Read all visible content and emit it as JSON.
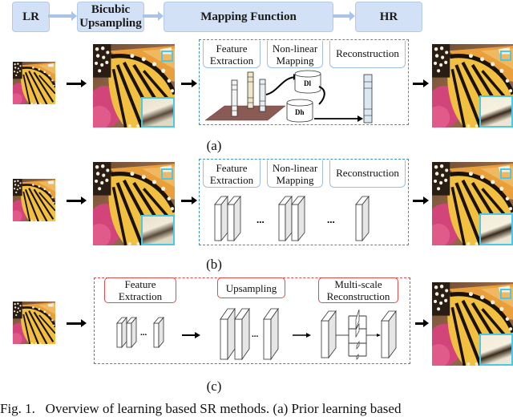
{
  "header": {
    "stages": [
      {
        "label": "LR"
      },
      {
        "label": "Bicubic\nUpsampling"
      },
      {
        "label": "Mapping Function"
      },
      {
        "label": "HR"
      }
    ]
  },
  "rows": [
    {
      "id": "a",
      "sublabel": "(a)",
      "stages": [
        "Feature\nExtraction",
        "Non-linear\nMapping",
        "Reconstruction"
      ],
      "dictionaries": [
        "Dl",
        "Dh"
      ],
      "box_color": "#3f8fd0"
    },
    {
      "id": "b",
      "sublabel": "(b)",
      "stages": [
        "Feature\nExtraction",
        "Non-linear\nMapping",
        "Reconstruction"
      ],
      "ellipsis": [
        "...",
        "..."
      ],
      "box_color": "#3f8fd0"
    },
    {
      "id": "c",
      "sublabel": "(c)",
      "stages": [
        "Feature\nExtraction",
        "Upsampling",
        "Multi-scale\nReconstruction"
      ],
      "ellipsis": [
        "...",
        "..."
      ],
      "box_color": "#e04a4a"
    }
  ],
  "colors": {
    "header_fill": "#d3e1f6",
    "header_arrow": "#a9c4ec",
    "inset_border": "#4cc7e8",
    "blue_dash": "#3f8fd0",
    "red_dash": "#e04a4a"
  },
  "caption": "Fig. 1.   Overview of learning based SR methods. (a) Prior learning based"
}
